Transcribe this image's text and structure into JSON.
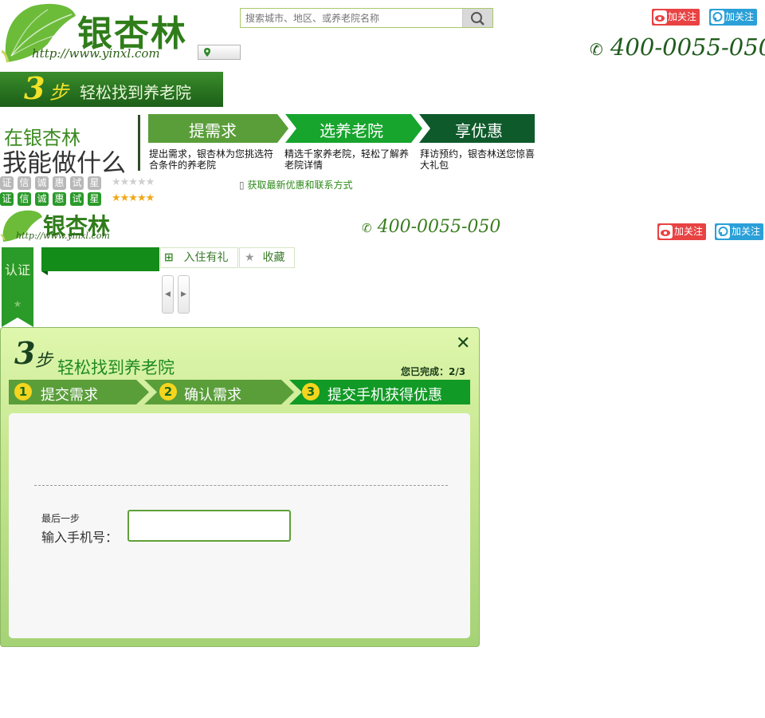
{
  "header": {
    "logo_cn": "银杏林",
    "logo_url": "http://www.yinxl.com",
    "search_placeholder": "搜索城市、地区、或养老院名称",
    "weibo_follow": "加关注",
    "qq_follow": "加关注",
    "phone": "400-0055-050"
  },
  "banner": {
    "steps_num": "3",
    "steps_bu": "步",
    "steps_text": "轻松找到养老院"
  },
  "intro": {
    "line1": "在银杏林",
    "line2": "我能做什么",
    "steps": [
      {
        "title": "提需求",
        "desc": "提出需求，银杏林为您挑选符合条件的养老院"
      },
      {
        "title": "选养老院",
        "desc": "精选千家养老院，轻松了解养老院详情"
      },
      {
        "title": "享优惠",
        "desc": "拜访预约，银杏林送您惊喜大礼包"
      }
    ],
    "badges": [
      "证",
      "信",
      "诚",
      "惠",
      "试",
      "星"
    ],
    "stars_empty": "★★★★★",
    "stars_full": "★★★★★",
    "contact_link": "获取最新优惠和联系方式"
  },
  "sub_header": {
    "logo_cn": "银杏林",
    "logo_url": "http://www.yinxl.com",
    "phone": "400-0055-050",
    "weibo_follow": "加关注",
    "qq_follow": "加关注"
  },
  "detail": {
    "cert_label": "认证",
    "cert_star": "★",
    "tab_gift": "入住有礼",
    "tab_fav": "收藏",
    "arrow_left": "◀",
    "arrow_right": "▶"
  },
  "modal": {
    "close": "✕",
    "title_num": "3",
    "title_bu": "步",
    "title": "轻松找到养老院",
    "progress": "您已完成：2/3",
    "wizard_steps": [
      {
        "num": "1",
        "label": "提交需求"
      },
      {
        "num": "2",
        "label": "确认需求"
      },
      {
        "num": "3",
        "label": "提交手机获得优惠"
      }
    ],
    "last_step": "最后一步",
    "phone_label": "输入手机号：",
    "phone_value": ""
  },
  "colors": {
    "brand_green": "#2f7d1a",
    "step1": "#5a9e3a",
    "step2": "#17a52d",
    "step3": "#0e5a2a",
    "accent_yellow": "#f3e229"
  }
}
